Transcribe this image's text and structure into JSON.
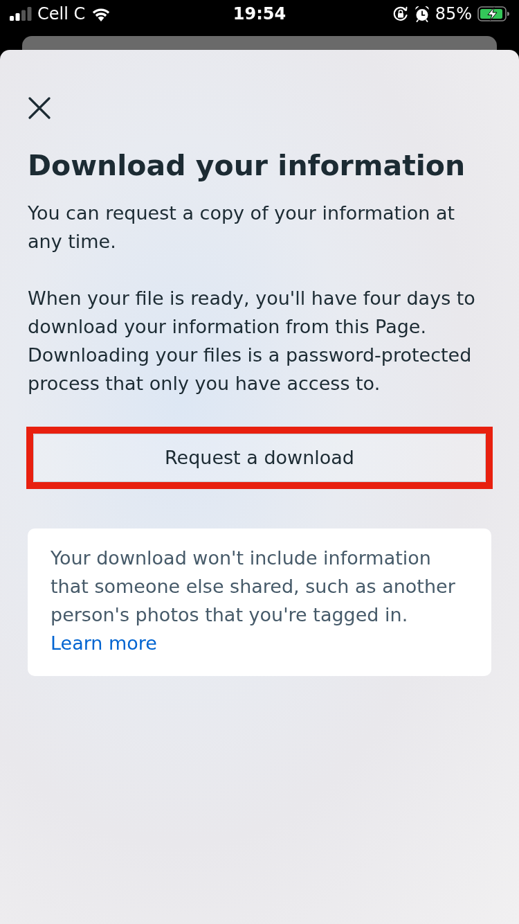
{
  "status_bar": {
    "carrier": "Cell C",
    "time": "19:54",
    "battery": "85%"
  },
  "sheet": {
    "title": "Download your information",
    "paragraphs": [
      "You can request a copy of your information at any time.",
      "When your file is ready, you'll have four days to download your information from this Page. Downloading your files is a password-protected process that only you have access to."
    ],
    "primary_button": {
      "label": "Request a download",
      "highlighted": true
    },
    "notice": {
      "text": "Your download won't include information that someone else shared, such as another person's photos that you're tagged in.",
      "link": "Learn more"
    }
  }
}
